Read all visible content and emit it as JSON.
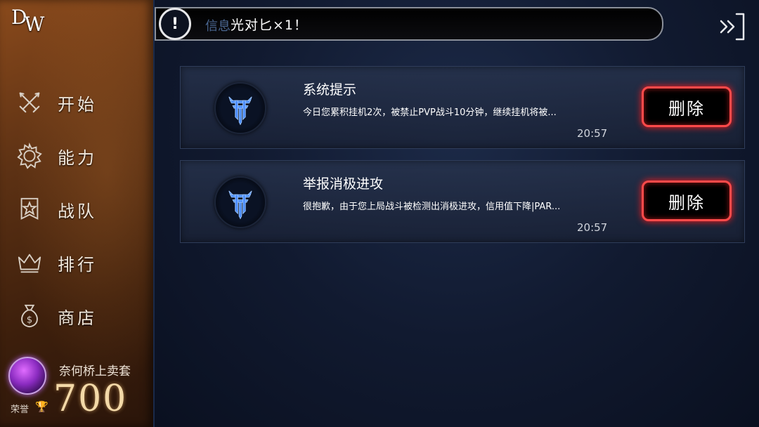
{
  "app": {
    "logo_d": "D",
    "logo_w": "W"
  },
  "sidebar": {
    "items": [
      {
        "label": "开始",
        "icon": "crossed-swords-icon"
      },
      {
        "label": "能力",
        "icon": "gear-icon"
      },
      {
        "label": "战队",
        "icon": "star-banner-icon"
      },
      {
        "label": "排行",
        "icon": "crown-icon"
      },
      {
        "label": "商店",
        "icon": "money-bag-icon"
      }
    ]
  },
  "profile": {
    "name": "奈何桥上卖套",
    "honor_label": "荣誉",
    "honor_icon": "trophy-icon",
    "honor_value": "700"
  },
  "notice": {
    "icon": "exclamation-icon",
    "ghost_text": "信息",
    "text": "光对匕×1！"
  },
  "messages": [
    {
      "title": "系统提示",
      "body": "今日您累积挂机2次，被禁止PVP战斗10分钟，继续挂机将被...",
      "time": "20:57",
      "delete_label": "删除"
    },
    {
      "title": "举报消极进攻",
      "body": "很抱歉，由于您上局战斗被检测出消极进攻，信用值下降|PAR...",
      "time": "20:57",
      "delete_label": "删除"
    }
  ],
  "colors": {
    "accent_red": "#ff4a4a",
    "logo_blue": "#4a8cff",
    "sidebar_brown": "#5e3214",
    "main_bg": "#111a30"
  }
}
